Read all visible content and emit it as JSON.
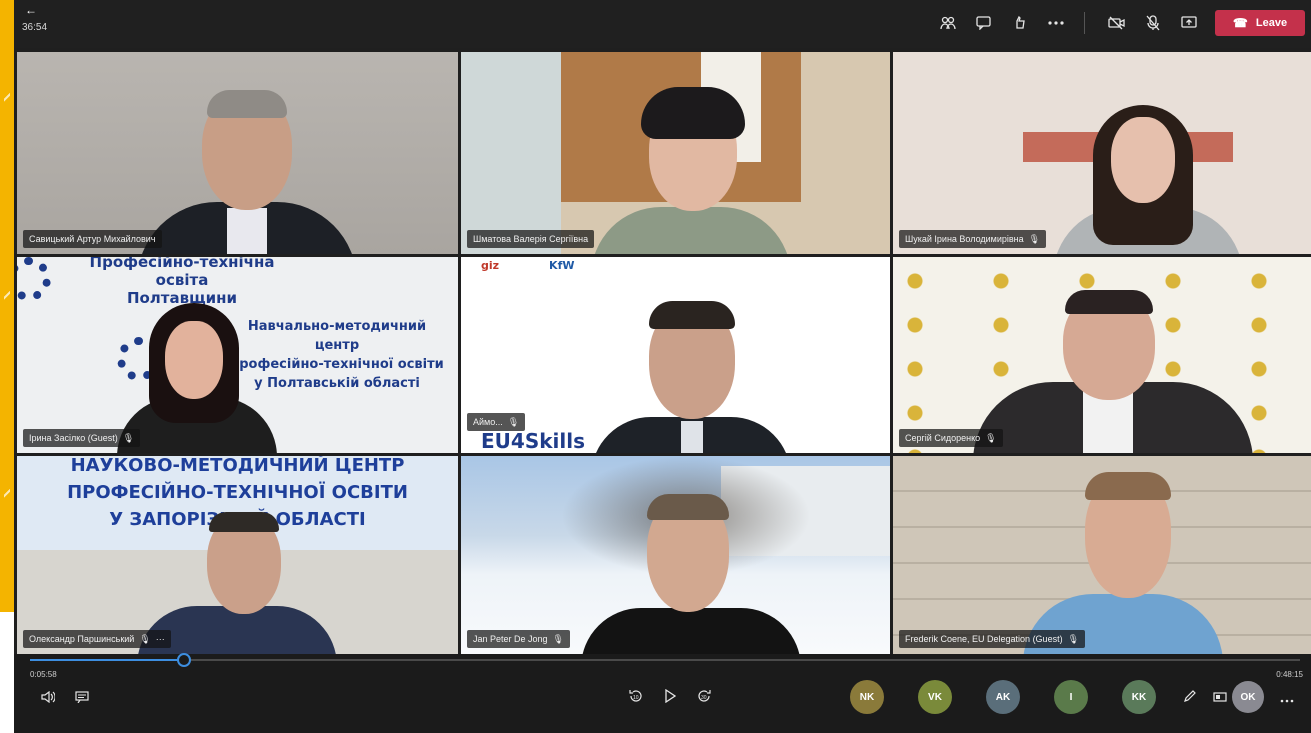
{
  "topbar": {
    "back_icon": "←",
    "timer": "36:54",
    "icons": [
      {
        "name": "participants-icon",
        "glyph": "👥"
      },
      {
        "name": "chat-icon",
        "glyph": "▭"
      },
      {
        "name": "reactions-icon",
        "glyph": "✋"
      },
      {
        "name": "more-icon",
        "glyph": "···"
      },
      {
        "name": "camera-off-icon",
        "glyph": "🎥"
      },
      {
        "name": "mic-off-icon",
        "glyph": "🎙"
      },
      {
        "name": "share-icon",
        "glyph": "⬆"
      }
    ],
    "leave_label": "Leave",
    "leave_color": "#c4314b"
  },
  "participants": [
    {
      "name": "Савицький Артур Михайлович",
      "mic": false,
      "more": false
    },
    {
      "name": "Шматова Валерія Сергіївна",
      "mic": false,
      "more": false
    },
    {
      "name": "Шукай Ірина Володимирівна",
      "mic": true,
      "more": false
    },
    {
      "name": "Ірина Засілко (Guest)",
      "mic": true,
      "more": false
    },
    {
      "name": "Аймо...",
      "mic": true,
      "more": false
    },
    {
      "name": "Сергій Сидоренко",
      "mic": true,
      "more": false
    },
    {
      "name": "Олександр Паршинський",
      "mic": true,
      "more": true
    },
    {
      "name": "Jan Peter De Jong",
      "mic": true,
      "more": false
    },
    {
      "name": "Frederik Coene, EU Delegation (Guest)",
      "mic": true,
      "more": false
    }
  ],
  "banners": {
    "poltava_top": [
      "Професійно-технічна",
      "освіта",
      "Полтавщини"
    ],
    "poltava_center": [
      "Навчально-методичний",
      "центр",
      "професійно-технічної освіти",
      "у Полтавській області"
    ],
    "eu4skills": "EU4Skills",
    "logos": [
      "giz",
      "KfW"
    ],
    "zaporizhzhia": [
      "НАУКОВО-МЕТОДИЧНИЙ ЦЕНТР",
      "ПРОФЕСІЙНО-ТЕХНІЧНОЇ ОСВІТИ",
      "У ЗАПОРІЗЬКІЙ ОБЛАСТІ"
    ]
  },
  "player": {
    "current_time": "0:05:58",
    "end_time": "0:48:15",
    "progress": 0.121,
    "avatars": [
      {
        "initials": "NK",
        "color": "#8a7a3a"
      },
      {
        "initials": "VK",
        "color": "#7a8a3a"
      },
      {
        "initials": "AK",
        "color": "#5a6e7a"
      },
      {
        "initials": "I",
        "color": "#5a7a4a"
      },
      {
        "initials": "KK",
        "color": "#5a7a5a"
      }
    ],
    "self_avatar": "OK"
  }
}
